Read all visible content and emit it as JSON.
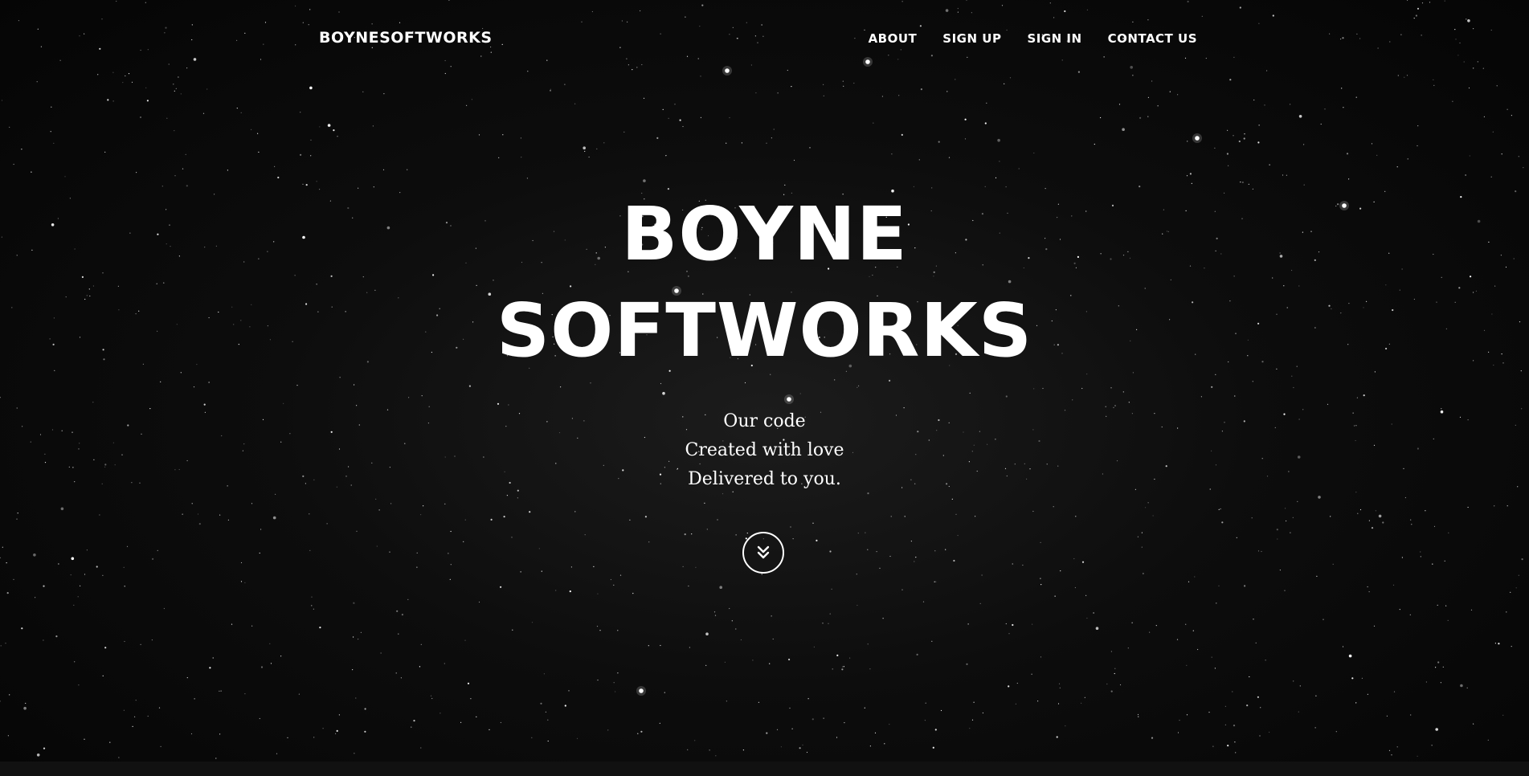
{
  "navbar": {
    "brand": "BOYNESOFTWORKS",
    "links": [
      "ABOUT",
      "SIGN UP",
      "SIGN IN",
      "CONTACT US"
    ]
  },
  "hero": {
    "headline_line1": "BOYNE",
    "headline_line2": "SOFTWORKS",
    "tagline": [
      "Our code",
      "Created with love",
      "Delivered to you."
    ],
    "scroll_icon": "double-chevron-down-icon"
  },
  "colors": {
    "background": "#0a0a0a",
    "text": "#ffffff"
  }
}
